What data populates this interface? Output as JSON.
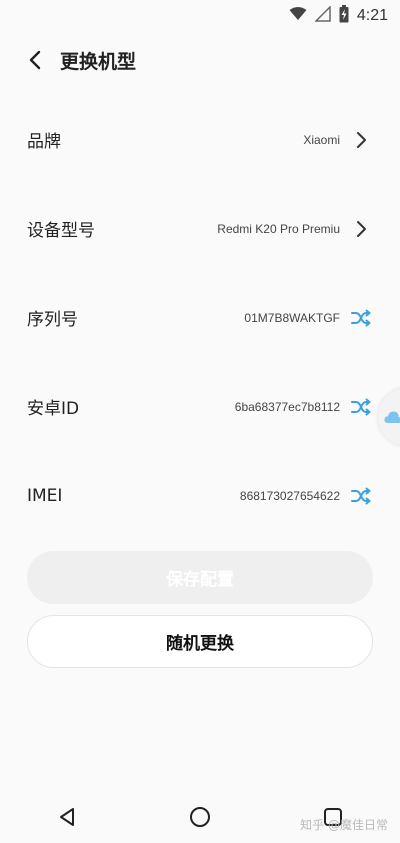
{
  "status_bar": {
    "time": "4:21",
    "icons": [
      "wifi-icon",
      "signal-icon",
      "battery-charging-icon"
    ]
  },
  "header": {
    "title": "更换机型",
    "back_icon": "back-chevron-icon"
  },
  "rows": [
    {
      "label": "品牌",
      "value": "Xiaomi",
      "action_icon": "chevron-right-icon"
    },
    {
      "label": "设备型号",
      "value": "Redmi K20 Pro Premiu",
      "action_icon": "chevron-right-icon"
    },
    {
      "label": "序列号",
      "value": "01M7B8WAKTGF",
      "action_icon": "shuffle-icon"
    },
    {
      "label": "安卓ID",
      "value": "6ba68377ec7b8112",
      "action_icon": "shuffle-icon"
    },
    {
      "label": "IMEI",
      "value": "868173027654622",
      "action_icon": "shuffle-icon"
    }
  ],
  "buttons": {
    "save_label": "保存配置",
    "random_label": "随机更换"
  },
  "nav": {
    "back": "nav-back-icon",
    "home": "nav-home-icon",
    "recent": "nav-recent-icon"
  },
  "watermark": "知乎 @魔佳日常",
  "colors": {
    "accent": "#3aa0e0",
    "background": "#fafafa",
    "disabled_button": "#efefef"
  }
}
